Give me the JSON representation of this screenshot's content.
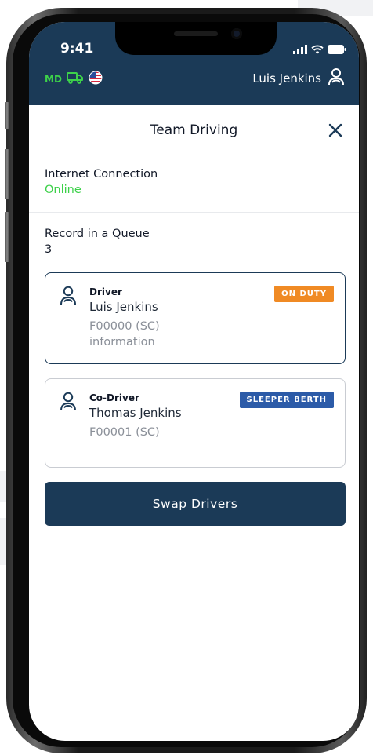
{
  "status_bar": {
    "time": "9:41",
    "icons": [
      "signal-icon",
      "wifi-icon",
      "battery-icon"
    ]
  },
  "app_bar": {
    "state_code": "MD",
    "truck_icon": "truck-icon",
    "flag_icon": "us-flag-icon",
    "user_name": "Luis Jenkins",
    "user_icon": "person-icon"
  },
  "title_bar": {
    "title": "Team Driving",
    "close_icon": "close-icon"
  },
  "internet": {
    "label": "Internet Connection",
    "status": "Online",
    "status_color": "#3dd14a"
  },
  "queue": {
    "label": "Record in a Queue",
    "count": "3"
  },
  "drivers": [
    {
      "role": "Driver",
      "name": "Luis Jenkins",
      "id": "F00000 (SC)",
      "extra": "information",
      "status": "ON DUTY",
      "status_color": "#f08a24",
      "selected": true
    },
    {
      "role": "Co-Driver",
      "name": "Thomas Jenkins",
      "id": "F00001 (SC)",
      "status": "SLEEPER BERTH",
      "status_color": "#2c5ba8",
      "selected": false
    }
  ],
  "actions": {
    "swap_label": "Swap Drivers"
  },
  "colors": {
    "primary": "#1b3a57",
    "online": "#3dd14a"
  }
}
